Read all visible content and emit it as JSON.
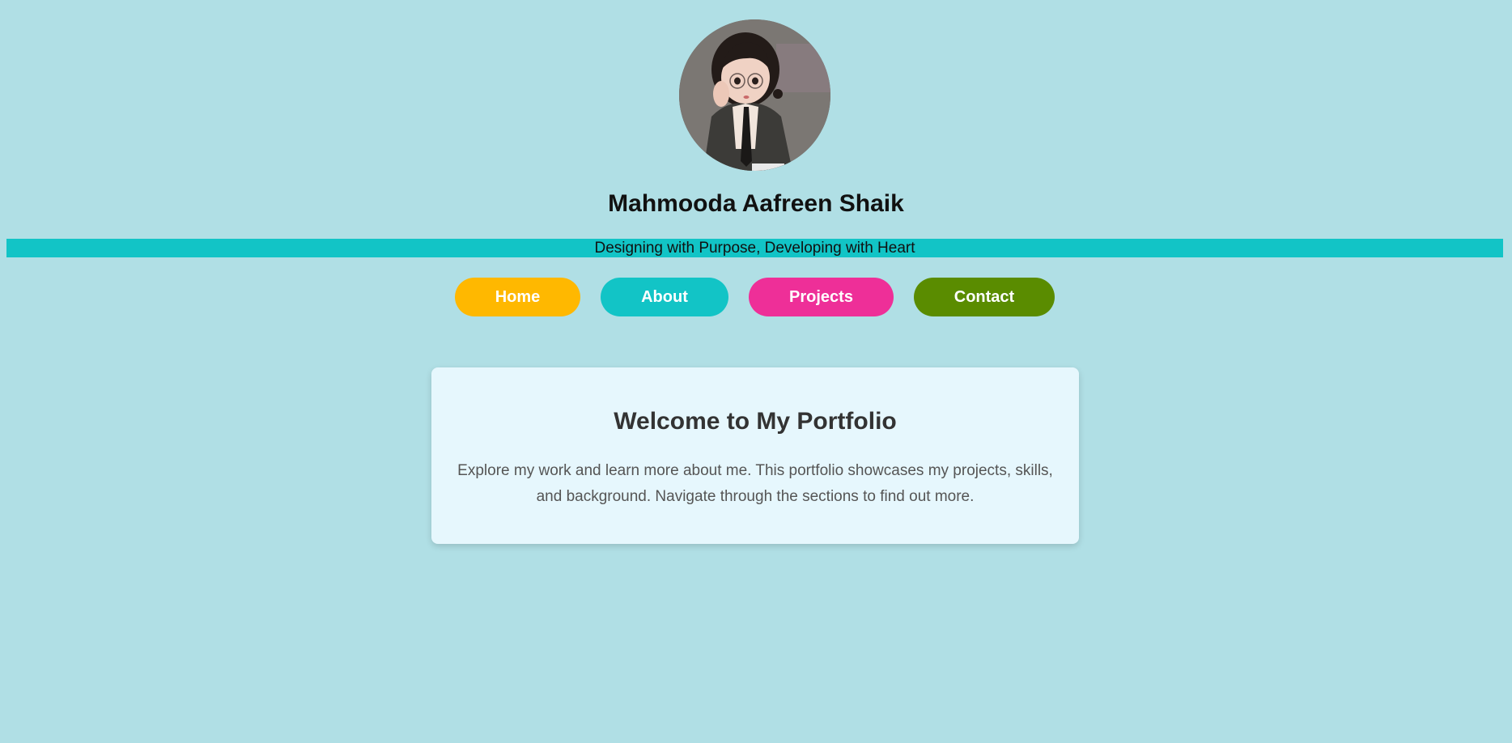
{
  "profile": {
    "avatar_alt": "Profile picture",
    "name": "Mahmooda Aafreen Shaik",
    "tagline": "Designing with Purpose, Developing with Heart"
  },
  "nav": {
    "items": [
      {
        "label": "Home",
        "color": "#ffb800"
      },
      {
        "label": "About",
        "color": "#12c4c6"
      },
      {
        "label": "Projects",
        "color": "#ee2f98"
      },
      {
        "label": "Contact",
        "color": "#5a8c00"
      }
    ]
  },
  "welcome": {
    "title": "Welcome to My Portfolio",
    "body": "Explore my work and learn more about me. This portfolio showcases my projects, skills, and background. Navigate through the sections to find out more."
  },
  "colors": {
    "page_background": "#b0dfe5",
    "tagline_bar": "#12c4c6",
    "card_background": "#e6f7fd"
  }
}
